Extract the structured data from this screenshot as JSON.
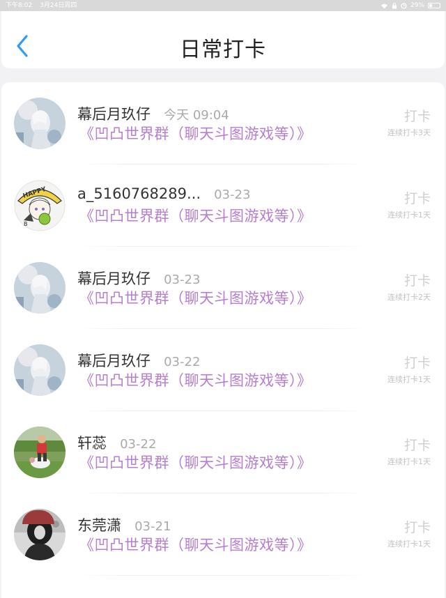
{
  "status_bar": {
    "time": "下午8:02",
    "date": "3月24日周四",
    "battery": "29%",
    "battery_level": 0.29
  },
  "header": {
    "back_icon": "chevron-left-icon",
    "title": "日常打卡",
    "accent_color": "#2f9bf5"
  },
  "colors": {
    "group_text": "#b57ed0",
    "date_text": "#aaaaaa",
    "checkin_text": "#cfcfcf"
  },
  "records": [
    {
      "name": "幕后月玖仔",
      "date": "今天 09:04",
      "group": "《凹凸世界群（聊天斗图游戏等）》",
      "checkin_label": "打卡",
      "streak": "连续打卡3天",
      "avatar": "anime-girl-avatar"
    },
    {
      "name": "a_5160768289...",
      "date": "03-23",
      "group": "《凹凸世界群（聊天斗图游戏等）》",
      "checkin_label": "打卡",
      "streak": "连续打卡1天",
      "avatar": "happy-character-avatar"
    },
    {
      "name": "幕后月玖仔",
      "date": "03-23",
      "group": "《凹凸世界群（聊天斗图游戏等）》",
      "checkin_label": "打卡",
      "streak": "连续打卡2天",
      "avatar": "anime-girl-avatar"
    },
    {
      "name": "幕后月玖仔",
      "date": "03-22",
      "group": "《凹凸世界群（聊天斗图游戏等）》",
      "checkin_label": "打卡",
      "streak": "连续打卡1天",
      "avatar": "anime-girl-avatar"
    },
    {
      "name": "轩蕊",
      "date": "03-22",
      "group": "《凹凸世界群（聊天斗图游戏等）》",
      "checkin_label": "打卡",
      "streak": "连续打卡1天",
      "avatar": "child-photo-avatar"
    },
    {
      "name": "东莞潇",
      "date": "03-21",
      "group": "《凹凸世界群（聊天斗图游戏等）》",
      "checkin_label": "打卡",
      "streak": "连续打卡1天",
      "avatar": "dark-portrait-avatar"
    }
  ]
}
